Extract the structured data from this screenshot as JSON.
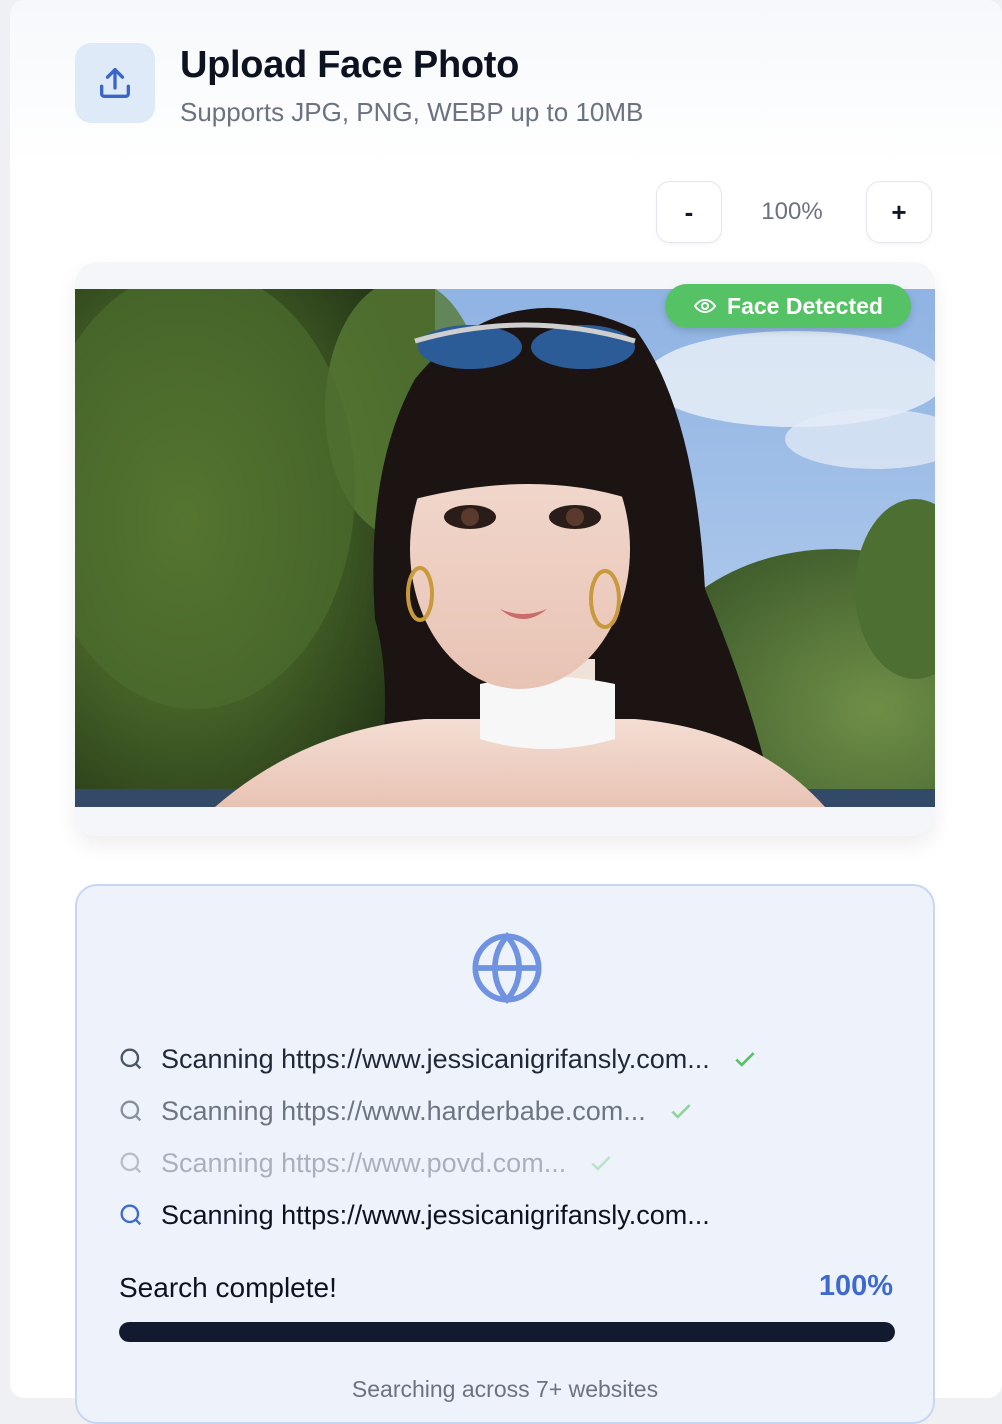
{
  "header": {
    "icon": "upload-icon",
    "title": "Upload Face Photo",
    "subtitle": "Supports JPG, PNG, WEBP up to 10MB"
  },
  "zoom": {
    "minus_label": "-",
    "level": "100%",
    "plus_label": "+"
  },
  "photo": {
    "badge_icon": "eye-icon",
    "badge_label": "Face Detected",
    "badge_color": "#55c266"
  },
  "scan": {
    "icon": "globe-icon",
    "rows": [
      {
        "text": "Scanning https://www.jessicanigrifansly.com...",
        "status": "done"
      },
      {
        "text": "Scanning https://www.harderbabe.com...",
        "status": "done"
      },
      {
        "text": "Scanning https://www.povd.com...",
        "status": "done"
      },
      {
        "text": "Scanning https://www.jessicanigrifansly.com...",
        "status": "active"
      }
    ],
    "complete_label": "Search complete!",
    "progress_text": "100%",
    "progress_value": 1.0,
    "footer": "Searching across 7+ websites",
    "accent_color": "#3e6ad0",
    "check_color": "#55c266"
  }
}
